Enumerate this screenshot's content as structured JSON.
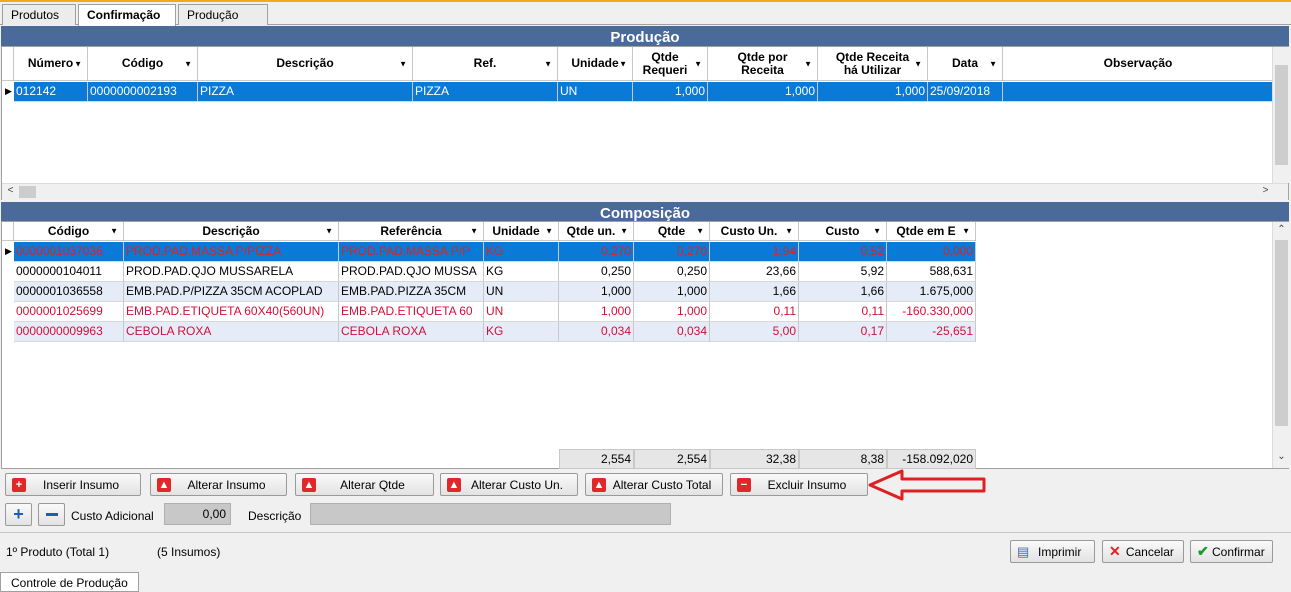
{
  "tabs": [
    "Produtos",
    "Confirmação",
    "Produção"
  ],
  "producao": {
    "title": "Produção",
    "headers": [
      "Número",
      "Código",
      "Descrição",
      "Ref.",
      "Unidade",
      "Qtde Requeri",
      "Qtde por Receita",
      "Qtde Receita há Utilizar",
      "Data",
      "Observação"
    ],
    "row": [
      "012142",
      "0000000002193",
      "PIZZA",
      "PIZZA",
      "UN",
      "1,000",
      "1,000",
      "1,000",
      "25/09/2018",
      ""
    ]
  },
  "composicao": {
    "title": "Composição",
    "headers": [
      "Código",
      "Descrição",
      "Referência",
      "Unidade",
      "Qtde un.",
      "Qtde",
      "Custo Un.",
      "Custo",
      "Qtde em E"
    ],
    "rows": [
      [
        "0000001037036",
        "PROD.PAD.MASSA P/PIZZA",
        "PROD.PAD.MASSA P/P",
        "KG",
        "0,270",
        "0,270",
        "1,94",
        "0,52",
        "0,000"
      ],
      [
        "0000000104011",
        "PROD.PAD.QJO MUSSARELA",
        "PROD.PAD.QJO MUSSA",
        "KG",
        "0,250",
        "0,250",
        "23,66",
        "5,92",
        "588,631"
      ],
      [
        "0000001036558",
        "EMB.PAD.P/PIZZA 35CM ACOPLAD",
        "EMB.PAD.PIZZA 35CM",
        "UN",
        "1,000",
        "1,000",
        "1,66",
        "1,66",
        "1.675,000"
      ],
      [
        "0000001025699",
        "EMB.PAD.ETIQUETA 60X40(560UN)",
        "EMB.PAD.ETIQUETA 60",
        "UN",
        "1,000",
        "1,000",
        "0,11",
        "0,11",
        "-160.330,000"
      ],
      [
        "0000000009963",
        "CEBOLA ROXA",
        "CEBOLA ROXA",
        "KG",
        "0,034",
        "0,034",
        "5,00",
        "0,17",
        "-25,651"
      ]
    ],
    "totals": [
      "2,554",
      "2,554",
      "32,38",
      "8,38",
      "-158.092,020"
    ]
  },
  "buttons": {
    "inserir": "Inserir Insumo",
    "alterar": "Alterar Insumo",
    "alterar_qtde": "Alterar Qtde",
    "alterar_custo_un": "Alterar Custo Un.",
    "alterar_custo_total": "Alterar Custo Total",
    "excluir": "Excluir Insumo"
  },
  "extra": {
    "custo_label": "Custo Adicional",
    "custo_value": "0,00",
    "descricao_label": "Descrição",
    "descricao_value": ""
  },
  "status": {
    "produto": "1º Produto (Total 1)",
    "insumos": "(5 Insumos)"
  },
  "actions": {
    "imprimir": "Imprimir",
    "cancelar": "Cancelar",
    "confirmar": "Confirmar"
  },
  "bottom_tab": "Controle de Produção"
}
